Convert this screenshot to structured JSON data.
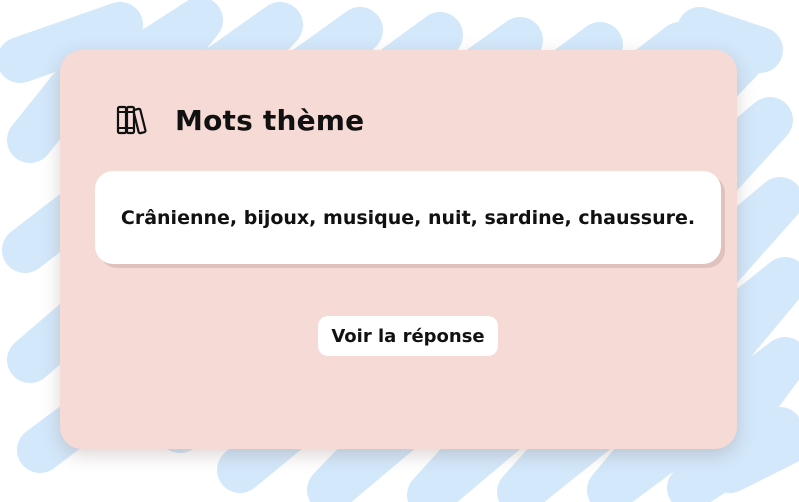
{
  "card": {
    "icon": "books-icon",
    "title": "Mots thème",
    "words": "Crânienne, bijoux, musique, nuit, sardine, chaussure.",
    "answer_button": "Voir la réponse"
  },
  "colors": {
    "background_scribble": "#d3e8fb",
    "card_background": "#f5dad6",
    "box_background": "#ffffff",
    "text": "#111111"
  }
}
